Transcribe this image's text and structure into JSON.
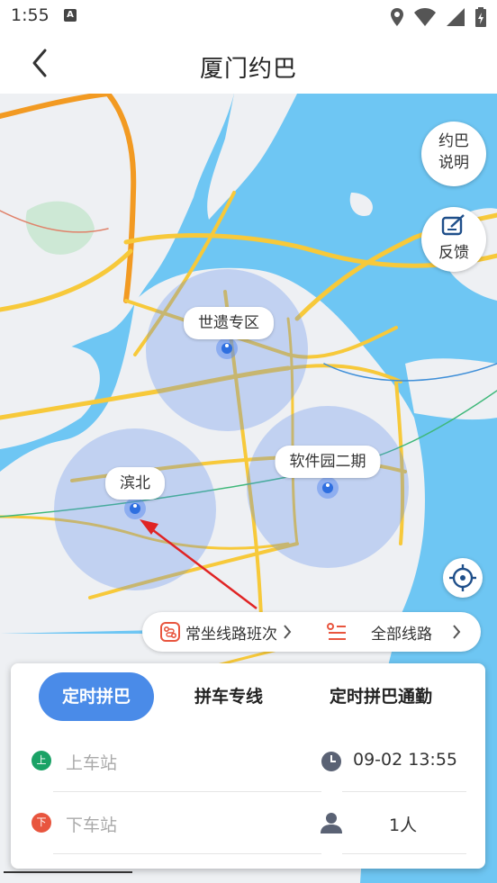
{
  "status": {
    "time": "1:55",
    "notif_letter": "A"
  },
  "header": {
    "title": "厦门约巴"
  },
  "side_buttons": {
    "explain": {
      "line1": "约巴",
      "line2": "说明"
    },
    "feedback": {
      "label": "反馈"
    }
  },
  "zones": [
    {
      "label": "世遗专区"
    },
    {
      "label": "软件园二期"
    },
    {
      "label": "滨北"
    }
  ],
  "route_bar": {
    "frequent": "常坐线路班次",
    "all": "全部线路"
  },
  "tabs": [
    {
      "label": "定时拼巴",
      "active": true
    },
    {
      "label": "拼车专线",
      "active": false
    },
    {
      "label": "定时拼巴通勤",
      "active": false
    }
  ],
  "form": {
    "pickup": {
      "badge": "上",
      "placeholder": "上车站"
    },
    "dropoff": {
      "badge": "下",
      "placeholder": "下车站"
    },
    "time": {
      "value": "09-02 13:55"
    },
    "passengers": {
      "value": "1人"
    }
  },
  "colors": {
    "accent": "#4a8be8",
    "water": "#6ec6f3",
    "pickup": "#1aa266",
    "dropoff": "#e8553e",
    "zone": "#5b8cf0"
  }
}
